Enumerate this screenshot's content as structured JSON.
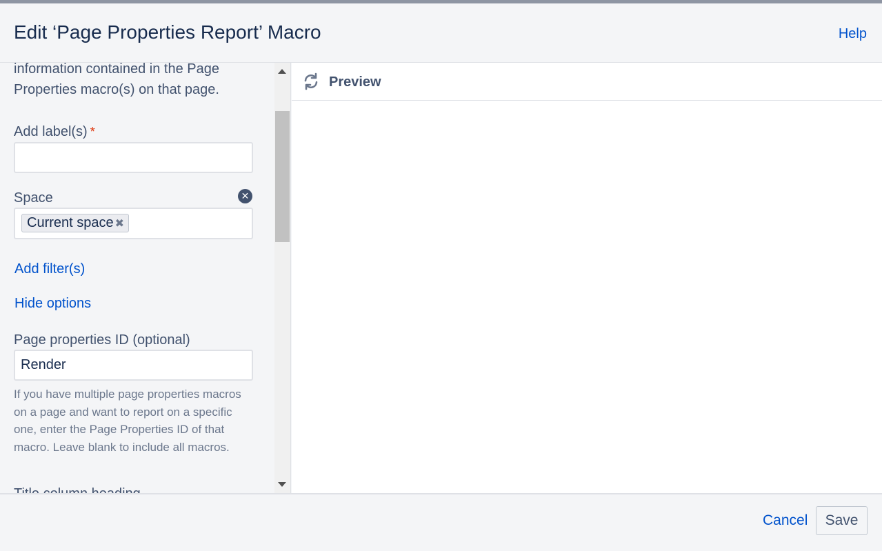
{
  "header": {
    "title": "Edit ‘Page Properties Report’ Macro",
    "help_label": "Help"
  },
  "form": {
    "description": "information contained in the Page Properties macro(s) on that page.",
    "labels_label": "Add label(s)",
    "required_marker": "*",
    "labels_value": "",
    "space_label": "Space",
    "space_chip": "Current space",
    "add_filters": "Add filter(s)",
    "hide_options": "Hide options",
    "page_props_id_label": "Page properties ID (optional)",
    "page_props_id_value": "Render",
    "page_props_id_help": "If you have multiple page properties macros on a page and want to report on a specific one, enter the Page Properties ID of that macro. Leave blank to include all macros.",
    "next_label_cut": "Title column heading"
  },
  "preview": {
    "title": "Preview",
    "refresh_icon": "refresh-icon"
  },
  "footer": {
    "cancel_label": "Cancel",
    "save_label": "Save"
  },
  "colors": {
    "link": "#0052cc",
    "text": "#172b4d",
    "muted": "#42526e",
    "required": "#de350b",
    "panel_bg": "#f4f5f7"
  }
}
